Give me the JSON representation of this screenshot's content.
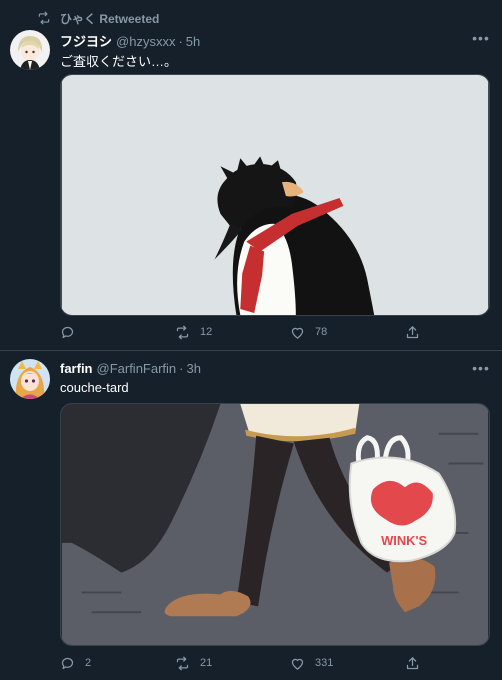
{
  "tweets": [
    {
      "retweet_label": "ひゃく Retweeted",
      "name": "フジヨシ",
      "handle": "@hzysxxx",
      "time": "5h",
      "text": "ご査収ください…。",
      "replies": "",
      "retweets": "12",
      "likes": "78"
    },
    {
      "name": "farfin",
      "handle": "@FarfinFarfin",
      "time": "3h",
      "text": "couche-tard",
      "replies": "2",
      "retweets": "21",
      "likes": "331",
      "bag_text": "WINK'S"
    }
  ],
  "icons": [
    "retweet-icon",
    "more-icon",
    "reply-icon",
    "like-icon",
    "share-icon"
  ],
  "colors": {
    "background": "#15202b",
    "secondary_text": "#8899a6",
    "border": "#38444d"
  }
}
